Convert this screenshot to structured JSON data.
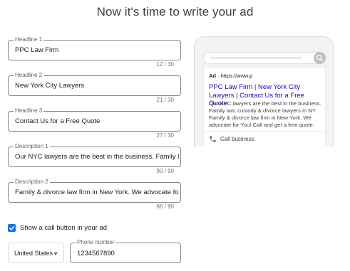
{
  "page": {
    "title": "Now it's time to write your ad"
  },
  "form": {
    "headline1": {
      "label": "Headline 1",
      "value": "PPC Law Firm",
      "counter": "12 / 30"
    },
    "headline2": {
      "label": "Headline 2",
      "value": "New York City Lawyers",
      "counter": "21 / 30"
    },
    "headline3": {
      "label": "Headline 3",
      "value": "Contact Us for a Free Quote",
      "counter": "27 / 30"
    },
    "description1": {
      "label": "Description 1",
      "value": "Our NYC lawyers are the best in the business. Family law, custody & divorce lawyers in NY.",
      "counter": "90 / 90"
    },
    "description2": {
      "label": "Description 2",
      "value": "Family & divorce law firm in New York. We advocate for You! Call and get a free quote.",
      "counter": "86 / 90"
    },
    "call_checkbox": {
      "label": "Show a call button in your ad",
      "checked": true
    },
    "country": {
      "value": "United States"
    },
    "phone": {
      "label": "Phone number",
      "value": "1234567890"
    }
  },
  "preview": {
    "ad_label": "Ad",
    "url": "· https://www.p",
    "headline": "PPC Law Firm | New York City Lawyers | Contact Us for a Free Quote",
    "description": "Our NYC lawyers are the best in the business. Family law, custody & divorce lawyers in NY. Family & divorce law firm in New York. We advocate for You! Call and get a free quote.",
    "call_label": "Call business"
  },
  "colors": {
    "accent": "#1a73e8",
    "link": "#1a0dab",
    "border": "#80868b"
  },
  "icons": [
    "search-icon",
    "phone-icon",
    "checkmark-icon",
    "dropdown-caret-icon"
  ]
}
